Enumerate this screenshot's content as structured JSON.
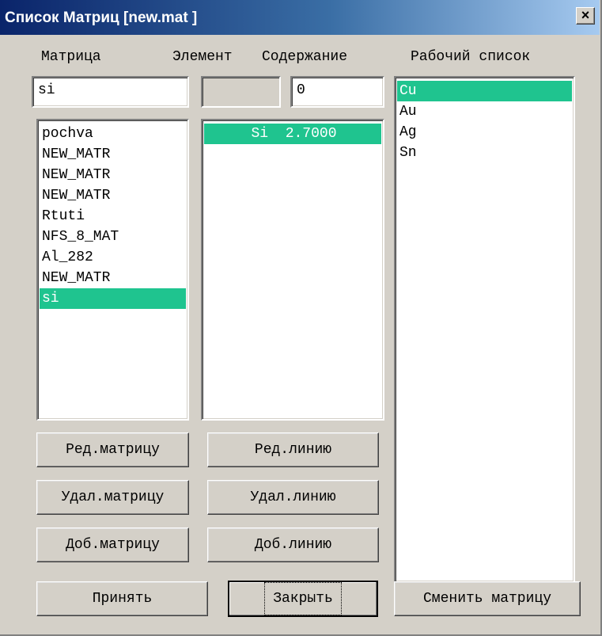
{
  "window": {
    "title": "Список Матриц [new.mat ]",
    "close_symbol": "×"
  },
  "headers": {
    "matrix": "Матрица",
    "element": "Элемент",
    "content": "Содержание",
    "working_list": "Рабочий список"
  },
  "inputs": {
    "matrix_value": "si",
    "element_value": "",
    "content_value": "0"
  },
  "matrix_list": {
    "items": [
      "pochva",
      "NEW_MATR",
      "NEW_MATR",
      "NEW_MATR",
      "Rtuti",
      "NFS_8_MAT",
      "Al_282",
      "NEW_MATR",
      "si"
    ],
    "selected_index": 8
  },
  "element_list": {
    "items": [
      "Si  2.7000"
    ],
    "selected_index": 0
  },
  "working_list": {
    "items": [
      "Cu",
      "Au",
      "Ag",
      "Sn"
    ],
    "selected_index": 0
  },
  "buttons": {
    "edit_matrix": "Ред.матрицу",
    "delete_matrix": "Удал.матрицу",
    "add_matrix": "Доб.матрицу",
    "edit_line": "Ред.линию",
    "delete_line": "Удал.линию",
    "add_line": "Доб.линию",
    "accept": "Принять",
    "close": "Закрыть",
    "change_matrix": "Сменить матрицу"
  },
  "colors": {
    "selection": "#1fc48f",
    "titlebar_start": "#0a246a",
    "titlebar_end": "#a6caf0",
    "face": "#d4d0c8"
  }
}
